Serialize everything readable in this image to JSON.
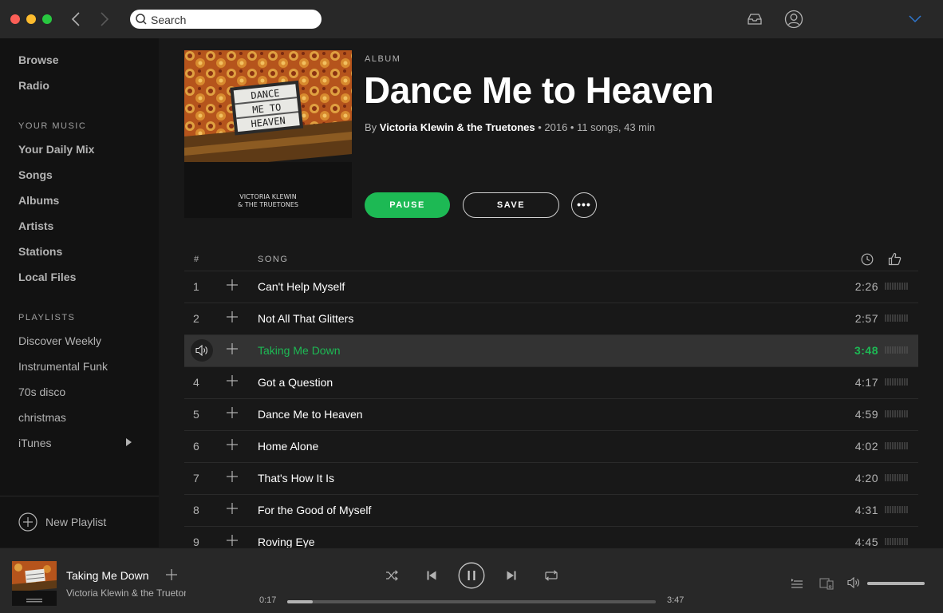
{
  "search": {
    "placeholder": "Search"
  },
  "sidebar": {
    "main_items": [
      {
        "label": "Browse"
      },
      {
        "label": "Radio"
      }
    ],
    "your_music_heading": "YOUR MUSIC",
    "your_music_items": [
      {
        "label": "Your Daily Mix"
      },
      {
        "label": "Songs"
      },
      {
        "label": "Albums"
      },
      {
        "label": "Artists"
      },
      {
        "label": "Stations"
      },
      {
        "label": "Local Files"
      }
    ],
    "playlists_heading": "PLAYLISTS",
    "playlists": [
      {
        "label": "Discover Weekly"
      },
      {
        "label": "Instrumental Funk"
      },
      {
        "label": "70s disco"
      },
      {
        "label": "christmas"
      },
      {
        "label": "iTunes"
      }
    ],
    "new_playlist_label": "New Playlist"
  },
  "album": {
    "type_label": "ALBUM",
    "title": "Dance Me to Heaven",
    "by_prefix": "By ",
    "artist": "Victoria Klewin & the Truetones",
    "meta_suffix": " • 2016 • 11 songs, 43 min",
    "cover_sign_lines": [
      "DANCE",
      "ME TO",
      "HEAVEN"
    ],
    "cover_artist_lines": [
      "VICTORIA KLEWIN",
      "& THE TRUETONES"
    ],
    "pause_label": "PAUSE",
    "save_label": "SAVE",
    "more_label": "•••"
  },
  "tracklist": {
    "col_num": "#",
    "col_song": "SONG",
    "tracks": [
      {
        "num": "1",
        "title": "Can't Help Myself",
        "duration": "2:26"
      },
      {
        "num": "2",
        "title": "Not All That Glitters",
        "duration": "2:57"
      },
      {
        "num": "",
        "title": "Taking Me Down",
        "duration": "3:48"
      },
      {
        "num": "4",
        "title": "Got a Question",
        "duration": "4:17"
      },
      {
        "num": "5",
        "title": "Dance Me to Heaven",
        "duration": "4:59"
      },
      {
        "num": "6",
        "title": "Home Alone",
        "duration": "4:02"
      },
      {
        "num": "7",
        "title": "That's How It Is",
        "duration": "4:20"
      },
      {
        "num": "8",
        "title": "For the Good of Myself",
        "duration": "4:31"
      },
      {
        "num": "9",
        "title": "Roving Eye",
        "duration": "4:45"
      }
    ]
  },
  "player": {
    "title": "Taking Me Down",
    "artist": "Victoria Klewin & the Truetones",
    "elapsed": "0:17",
    "total": "3:47",
    "progress_fraction": 0.07,
    "volume_fraction": 1.0
  },
  "colors": {
    "accent": "#1db954",
    "sidebar_bg": "#121212",
    "main_bg": "#181818",
    "bar_bg": "#282828"
  }
}
